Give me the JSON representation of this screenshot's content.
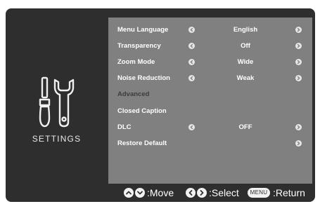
{
  "sidebar": {
    "title": "SETTINGS",
    "icon": "tools-icon"
  },
  "menu": {
    "items": [
      {
        "label": "Menu Language",
        "value": "English",
        "arrows": true,
        "dim": false
      },
      {
        "label": "Transparency",
        "value": "Off",
        "arrows": true,
        "dim": false
      },
      {
        "label": "Zoom Mode",
        "value": "Wide",
        "arrows": true,
        "dim": false
      },
      {
        "label": "Noise Reduction",
        "value": "Weak",
        "arrows": true,
        "dim": false
      },
      {
        "label": "Advanced",
        "value": "",
        "arrows": false,
        "dim": true
      },
      {
        "label": "Closed Caption",
        "value": "",
        "arrows": false,
        "dim": false
      },
      {
        "label": "DLC",
        "value": "OFF",
        "arrows": true,
        "dim": false
      },
      {
        "label": "Restore Default",
        "value": "",
        "arrows": false,
        "right_arrow_only": true,
        "dim": false
      }
    ]
  },
  "footer": {
    "move_label": ":Move",
    "select_label": ":Select",
    "menu_button": "MENU",
    "return_label": ":Return"
  },
  "colors": {
    "panel": "#2e2e2e",
    "menu_bg": "#808080",
    "text": "#ffffff",
    "dim_text": "#3c3c3c"
  }
}
